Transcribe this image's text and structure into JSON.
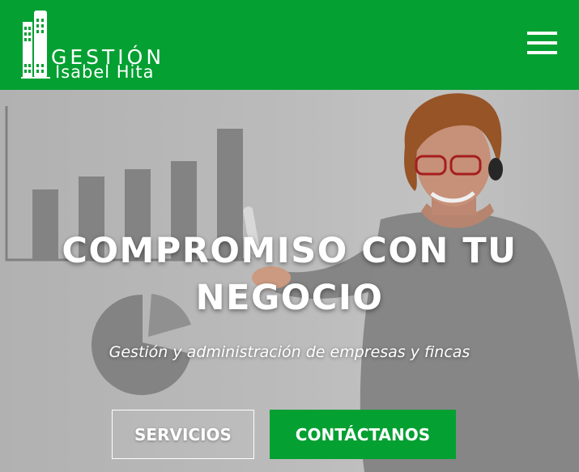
{
  "header": {
    "logo": {
      "line1": "GESTIÓN",
      "line2": "Isabel Hita",
      "icon": "buildings-logo-icon"
    },
    "menu_icon": "hamburger-menu-icon",
    "background_color": "#04a032"
  },
  "hero": {
    "title": "COMPROMISO CON TU NEGOCIO",
    "subtitle": "Gestión y administración de empresas y fincas",
    "buttons": {
      "services_label": "SERVICIOS",
      "contact_label": "CONTÁCTANOS"
    },
    "accent_color": "#04a032"
  }
}
